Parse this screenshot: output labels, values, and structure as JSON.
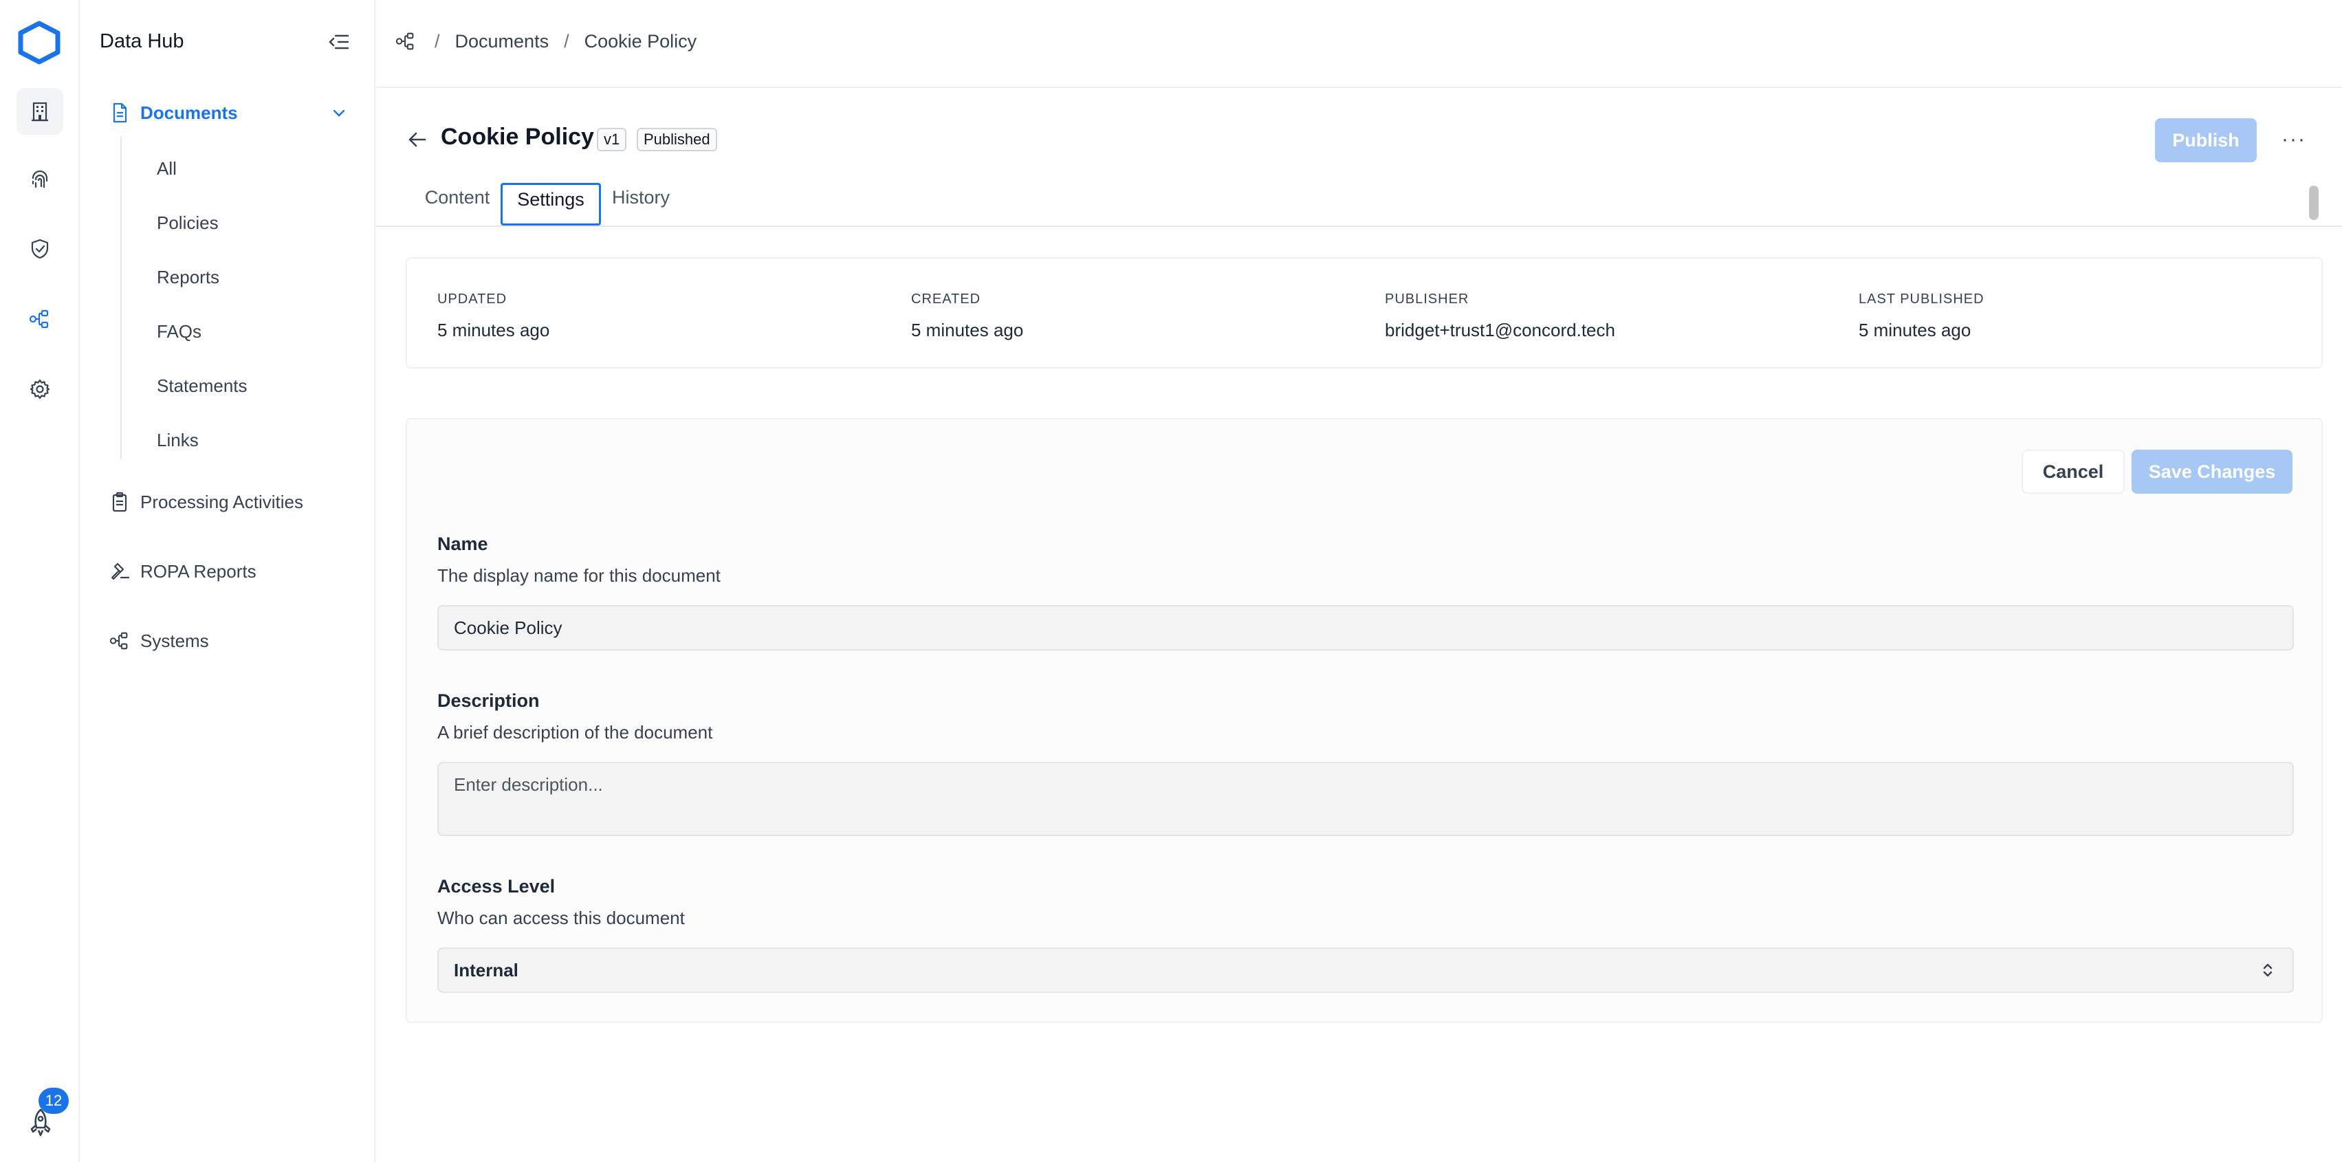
{
  "app": {
    "title": "Data Hub",
    "notifications_count": "12"
  },
  "rail": [
    "building-icon",
    "fingerprint-icon",
    "shield-check-icon",
    "share-nodes-icon",
    "gear-icon"
  ],
  "sidebar": {
    "documents_label": "Documents",
    "documents_sub": [
      "All",
      "Policies",
      "Reports",
      "FAQs",
      "Statements",
      "Links"
    ],
    "items": [
      {
        "label": "Processing Activities",
        "icon": "clipboard-icon"
      },
      {
        "label": "ROPA Reports",
        "icon": "gavel-icon"
      },
      {
        "label": "Systems",
        "icon": "share-nodes-icon"
      }
    ]
  },
  "breadcrumb": {
    "sep": "/",
    "section": "Documents",
    "current": "Cookie Policy"
  },
  "doc": {
    "title": "Cookie Policy",
    "version": "v1",
    "status": "Published",
    "publish_label": "Publish",
    "more_label": "···"
  },
  "tabs": [
    "Content",
    "Settings",
    "History"
  ],
  "meta": [
    {
      "label": "UPDATED",
      "value": "5 minutes ago"
    },
    {
      "label": "CREATED",
      "value": "5 minutes ago"
    },
    {
      "label": "PUBLISHER",
      "value": "bridget+trust1@concord.tech"
    },
    {
      "label": "LAST PUBLISHED",
      "value": "5 minutes ago"
    }
  ],
  "form": {
    "cancel_label": "Cancel",
    "save_label": "Save Changes",
    "name": {
      "label": "Name",
      "help": "The display name for this document",
      "value": "Cookie Policy"
    },
    "description": {
      "label": "Description",
      "help": "A brief description of the document",
      "placeholder": "Enter description..."
    },
    "access": {
      "label": "Access Level",
      "help": "Who can access this document",
      "value": "Internal"
    }
  },
  "colors": {
    "accent": "#1a73e8",
    "disabled_button": "#a7c7f5"
  }
}
